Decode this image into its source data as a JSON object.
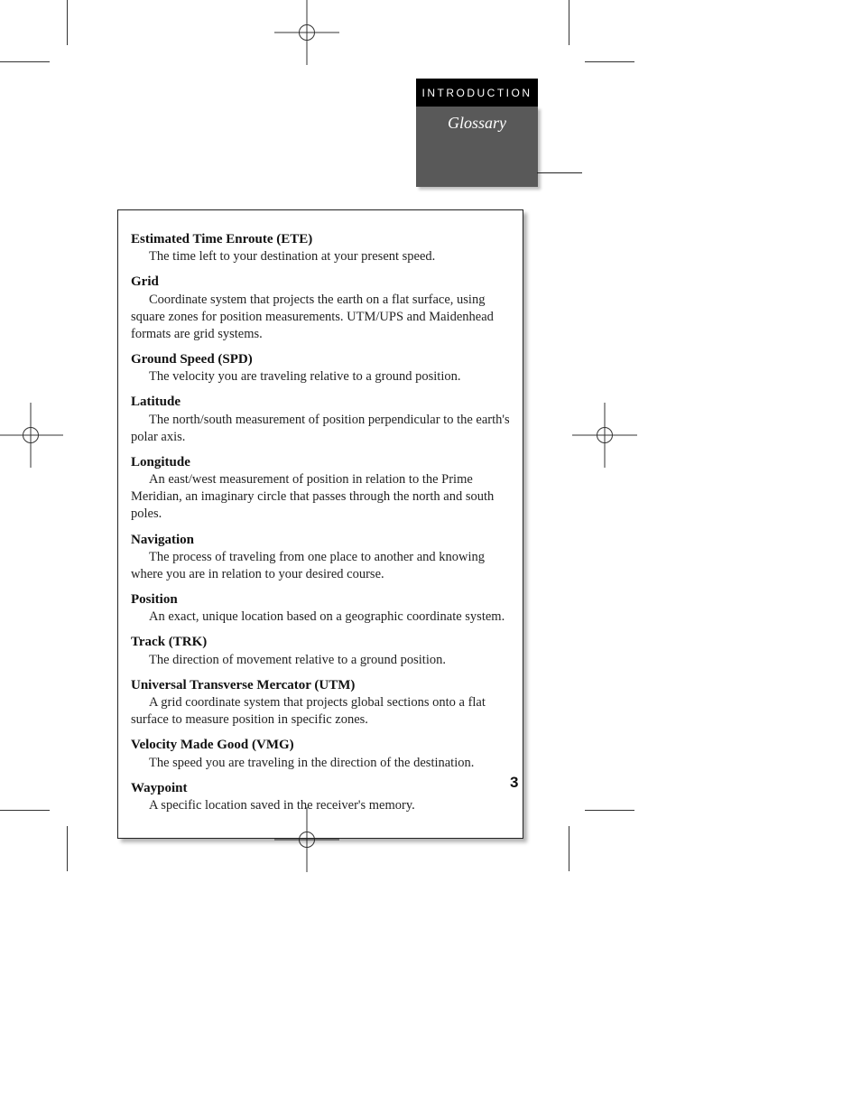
{
  "header": {
    "section": "INTRODUCTION",
    "title": "Glossary"
  },
  "page_number": "3",
  "glossary": [
    {
      "term": "Estimated Time Enroute (ETE)",
      "def": "The time left to your destination at your present speed."
    },
    {
      "term": "Grid",
      "def": "Coordinate system that projects the earth on a flat surface, using square zones for position measurements. UTM/UPS and Maidenhead formats are grid systems."
    },
    {
      "term": "Ground Speed (SPD)",
      "def": "The velocity you are traveling relative to a ground position."
    },
    {
      "term": "Latitude",
      "def": "The north/south measurement of position perpendicular to the earth's polar axis."
    },
    {
      "term": "Longitude",
      "def": "An east/west measurement of position in relation to the Prime Meridian, an imaginary circle that passes through the north and south poles."
    },
    {
      "term": "Navigation",
      "def": "The process of traveling from one place to another and knowing where you are in relation to your desired course."
    },
    {
      "term": "Position",
      "def": "An exact, unique location based on a geographic coordinate system."
    },
    {
      "term": "Track (TRK)",
      "def": "The direction of movement relative to a ground position."
    },
    {
      "term": "Universal Transverse Mercator (UTM)",
      "def": "A grid coordinate system that projects global sections onto a flat surface to measure position in specific zones."
    },
    {
      "term": "Velocity Made Good (VMG)",
      "def": "The speed you are traveling in the direction of the destination."
    },
    {
      "term": "Waypoint",
      "def": "A specific location saved in the receiver's memory."
    }
  ]
}
